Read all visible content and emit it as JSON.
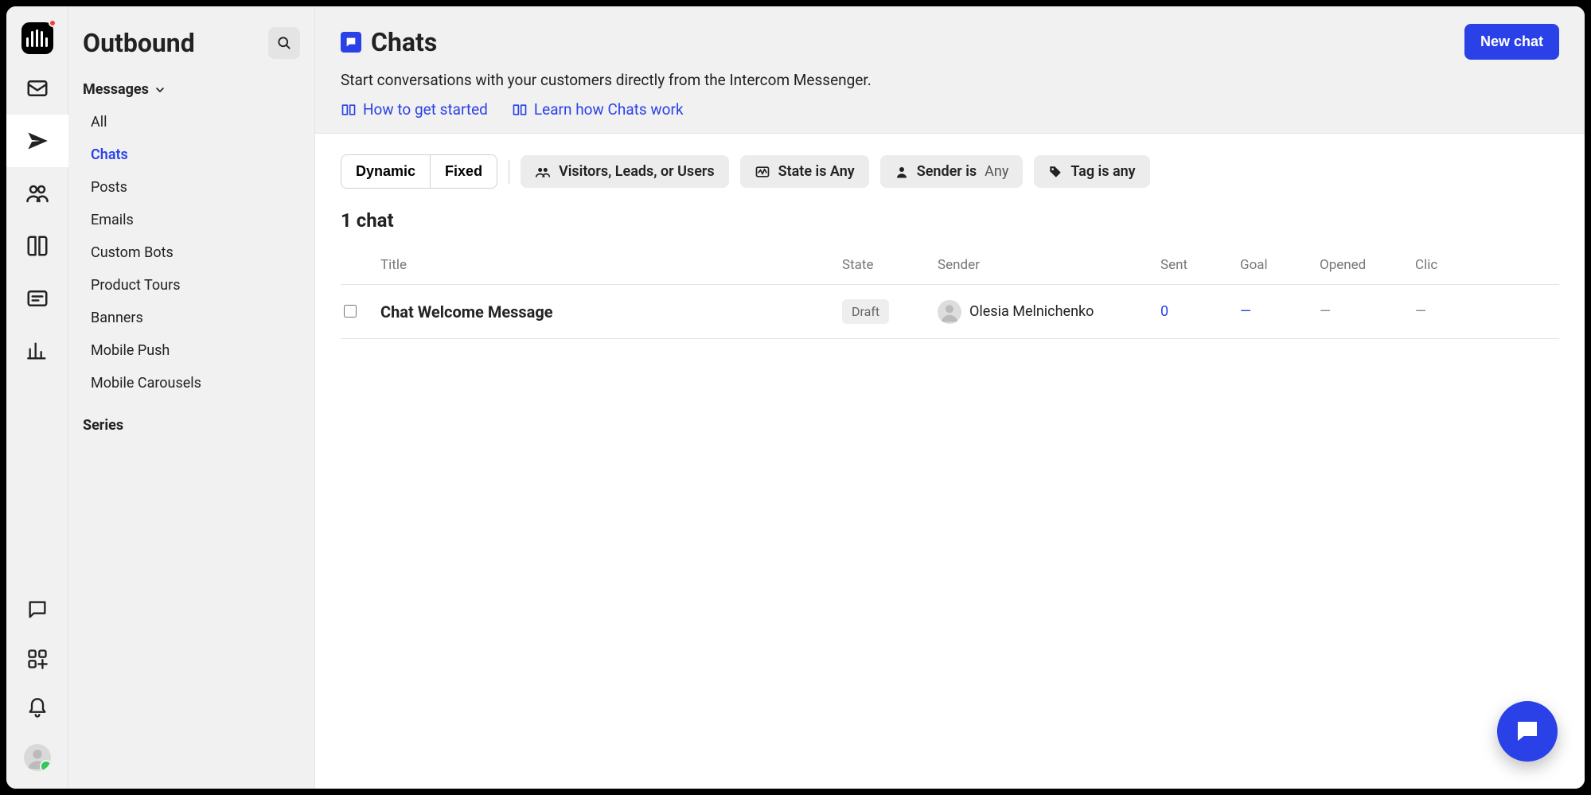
{
  "sidebar": {
    "workspace_title": "Outbound",
    "messages_label": "Messages",
    "items": [
      "All",
      "Chats",
      "Posts",
      "Emails",
      "Custom Bots",
      "Product Tours",
      "Banners",
      "Mobile Push",
      "Mobile Carousels"
    ],
    "active_index": 1,
    "series_label": "Series"
  },
  "header": {
    "title": "Chats",
    "subtitle": "Start conversations with your customers directly from the Intercom Messenger.",
    "help1": "How to get started",
    "help2": "Learn how Chats work",
    "new_button": "New chat"
  },
  "filters": {
    "seg1": "Dynamic",
    "seg2": "Fixed",
    "audience": "Visitors, Leads, or Users",
    "state_label": "State is Any",
    "sender_label": "Sender is",
    "sender_value": "Any",
    "tag_label": "Tag is any"
  },
  "list": {
    "count_label": "1 chat",
    "columns": {
      "title": "Title",
      "state": "State",
      "sender": "Sender",
      "sent": "Sent",
      "goal": "Goal",
      "opened": "Opened",
      "clicked": "Clic"
    },
    "rows": [
      {
        "title": "Chat Welcome Message",
        "state": "Draft",
        "sender": "Olesia Melnichenko",
        "sent": "0",
        "goal": "—",
        "opened": "—",
        "clicked": "—"
      }
    ]
  }
}
